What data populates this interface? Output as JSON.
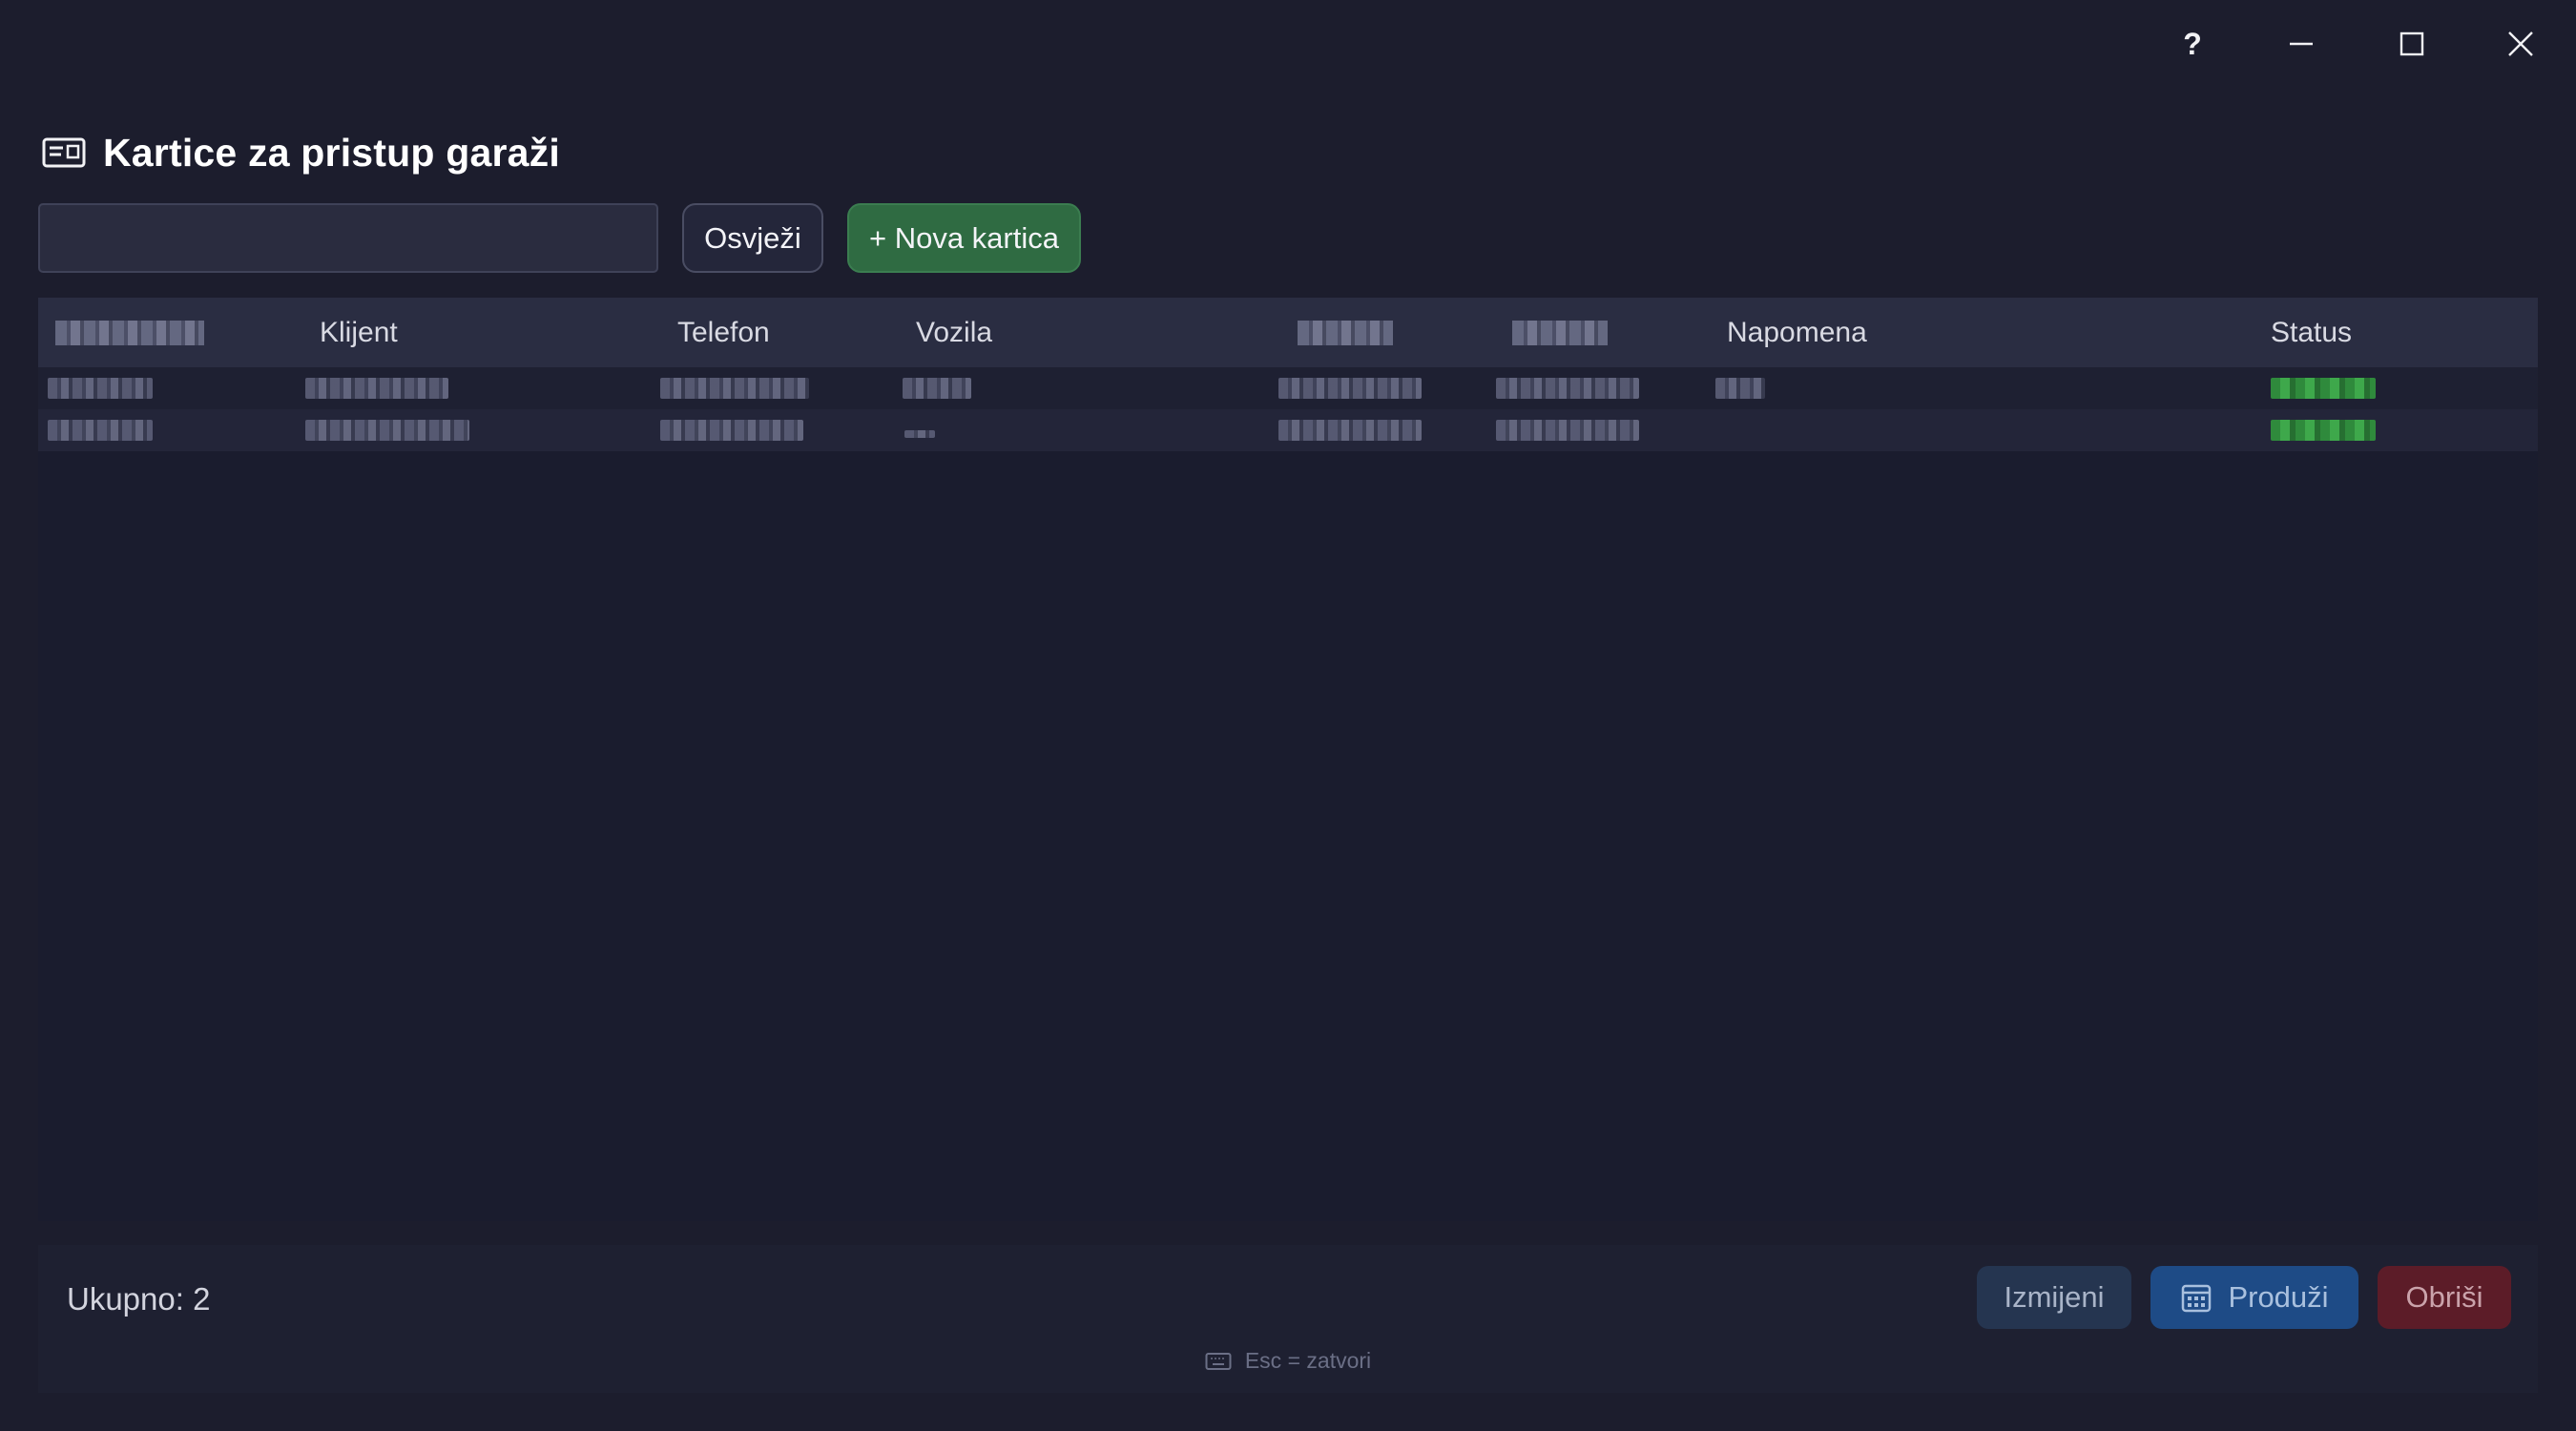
{
  "window": {
    "help_label": "?"
  },
  "header": {
    "title": "Kartice za pristup garaži",
    "icon": "card-icon"
  },
  "toolbar": {
    "search_value": "",
    "search_placeholder": "",
    "refresh_label": "Osvježi",
    "new_card_label": "+ Nova kartica",
    "new_card_color": "#2f6b42"
  },
  "table": {
    "columns": [
      "",
      "Klijent",
      "Telefon",
      "Vozila",
      "",
      "",
      "Napomena",
      "Status"
    ],
    "status_color": "#3ea84b"
  },
  "footer": {
    "total_label": "Ukupno: 2",
    "edit_label": "Izmijeni",
    "extend_label": "Produži",
    "delete_label": "Obriši",
    "hint_label": "Esc = zatvori"
  }
}
